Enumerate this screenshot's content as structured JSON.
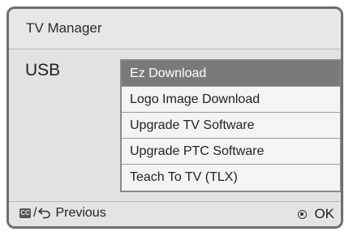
{
  "window": {
    "title": "TV Manager"
  },
  "section": {
    "label": "USB"
  },
  "menu": {
    "items": [
      {
        "label": "Ez Download",
        "selected": true
      },
      {
        "label": "Logo Image Download",
        "selected": false
      },
      {
        "label": "Upgrade TV Software",
        "selected": false
      },
      {
        "label": "Upgrade PTC Software",
        "selected": false
      },
      {
        "label": "Teach To TV (TLX)",
        "selected": false
      }
    ]
  },
  "footer": {
    "cc_icon_text": "CC",
    "separator": "/",
    "back_label": "Previous",
    "ok_label": "OK",
    "back_icon": "back-arrow-icon",
    "ok_icon": "ok-circle-icon"
  },
  "colors": {
    "frame_bg": "#e4e4e4",
    "frame_border": "#6e6e6e",
    "selected_bg": "#7a7a7a",
    "selected_text": "#ffffff"
  }
}
